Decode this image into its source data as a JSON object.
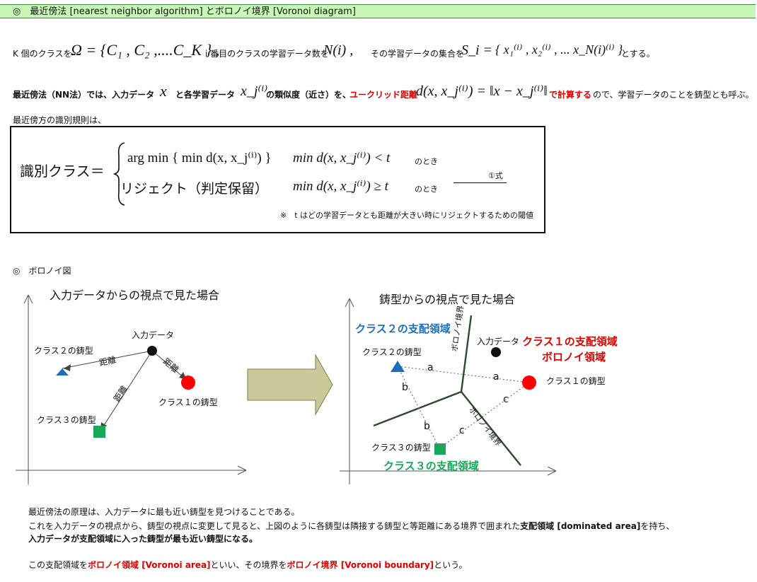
{
  "header": {
    "title": "◎　最近傍法 [nearest neighbor algorithm] とボロノイ境界 [Voronoi diagram]"
  },
  "line1": {
    "t1": "K 個のクラスを",
    "omega": "Ω = {C₁ , C₂ ,....C_K } ,",
    "t2": "i 番目のクラスの学習データ数を",
    "Ni": "N(i) ,",
    "t3": "その学習データの集合を",
    "Si": "S_i =",
    "set": "{ x₁⁽ⁱ⁾ , x₂⁽ⁱ⁾ , ... x_N(i)⁽ⁱ⁾ }",
    "t4": "とする。"
  },
  "line2": {
    "t1": "最近傍法（NN法）では、入力データ",
    "x": "x",
    "t2": "と各学習データ",
    "xj": "x_j⁽ⁱ⁾",
    "t3": "の類似度（近さ）を、",
    "red": "ユークリッド距離",
    "formula": "d(x, x_j⁽ⁱ⁾) = ‖x − x_j⁽ⁱ⁾‖",
    "red2": "で計算する",
    "t4": "ので、学習データのことを鋳型とも呼ぶ。"
  },
  "rule_intro": "最近傍方の識別規則は、",
  "rule": {
    "lhs": "識別クラス＝",
    "case1": "arg min { min d(x, x_j⁽ⁱ⁾) }",
    "cond1": "min d(x, x_j⁽ⁱ⁾) < t",
    "when1": "のとき",
    "case2": "リジェクト（判定保留）",
    "cond2": "min d(x, x_j⁽ⁱ⁾) ≥ t",
    "when2": "のとき",
    "eq_label": "①式",
    "note": "※　t はどの学習データとも距離が大きい時にリジェクトするための閾値"
  },
  "voronoi_heading": "◎　ボロノイ図",
  "left_fig": {
    "title": "入力データからの視点で見た場合",
    "input": "入力データ",
    "class1": "クラス１の鋳型",
    "class2": "クラス２の鋳型",
    "class3": "クラス３の鋳型",
    "dist": "距離"
  },
  "right_fig": {
    "title": "鋳型からの視点で見た場合",
    "region2": "クラス２の支配領域",
    "region1": "クラス１の支配領域",
    "voronoi_region": "ボロノイ領域",
    "region3": "クラス３の支配領域",
    "input": "入力データ",
    "class1": "クラス１の鋳型",
    "class2": "クラス２の鋳型",
    "class3": "クラス３の鋳型",
    "boundary": "ボロノイ境界",
    "a": "a",
    "b": "b",
    "c": "c"
  },
  "bottom": {
    "p1": "最近傍法の原理は、入力データに最も近い鋳型を見つけることである。",
    "p2a": "これを入力データの視点から、鋳型の視点に変更して見ると、上図のように各鋳型は隣接する鋳型と等距離にある境界で囲まれた",
    "p2b": "支配領域 [dominated area]",
    "p2c": "を持ち、",
    "p3": "入力データが支配領域に入った鋳型が最も近い鋳型になる。",
    "p4a": "この支配領域を",
    "p4b": "ボロノイ領域 [Voronoi area]",
    "p4c": "といい、その境界を",
    "p4d": "ボロノイ境界 [Voronoi boundary]",
    "p4e": "という。"
  },
  "colors": {
    "header_bg": "#c8f7b8",
    "red": "#e00000",
    "blue": "#1f6fb8",
    "green": "#19a85a",
    "arrow_fill": "#c9c99a"
  }
}
